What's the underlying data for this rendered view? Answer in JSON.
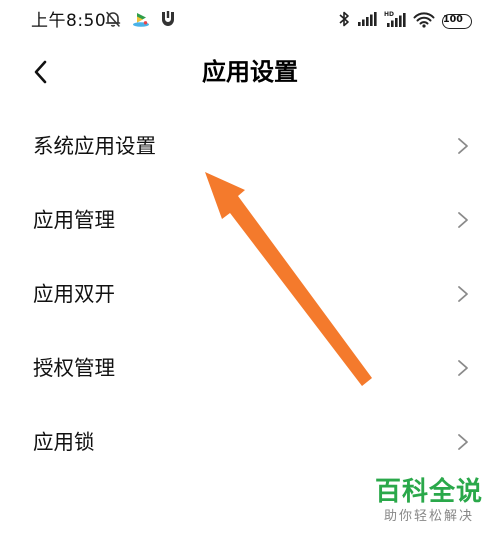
{
  "status_bar": {
    "time": "上午8:50",
    "battery": "100",
    "left_icons": [
      "alarm-off-icon",
      "app-notification-icon",
      "shield-app-icon"
    ],
    "right_icons": [
      "bluetooth-icon",
      "cellular-signal-icon",
      "hd-cellular-signal-icon",
      "wifi-icon",
      "battery-icon"
    ]
  },
  "header": {
    "title": "应用设置",
    "back_icon": "chevron-left-icon"
  },
  "settings": {
    "items": [
      {
        "label": "系统应用设置"
      },
      {
        "label": "应用管理"
      },
      {
        "label": "应用双开"
      },
      {
        "label": "授权管理"
      },
      {
        "label": "应用锁"
      }
    ],
    "chevron_icon": "chevron-right-icon"
  },
  "annotation": {
    "arrow_color": "#f47a2c",
    "target": "系统应用设置"
  },
  "watermark": {
    "main": "百科全说",
    "sub": "助你轻松解决",
    "color": "#2aa84a"
  }
}
